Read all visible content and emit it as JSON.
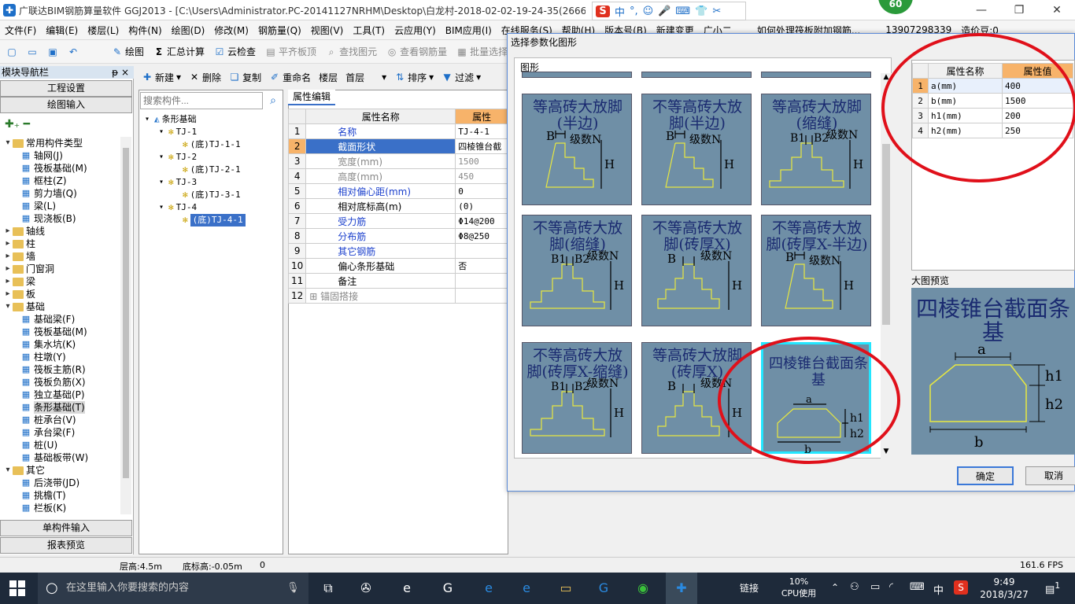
{
  "window": {
    "title": "广联达BIM钢筋算量软件 GGJ2013 - [C:\\Users\\Administrator.PC-20141127NRHM\\Desktop\\白龙村-2018-02-02-19-24-35(2666版",
    "score": "60"
  },
  "ime": {
    "logo": "S",
    "items": [
      "中",
      "°,",
      "☺",
      "🎤",
      "⌨",
      "👕",
      "✂"
    ]
  },
  "menu": [
    "文件(F)",
    "编辑(E)",
    "楼层(L)",
    "构件(N)",
    "绘图(D)",
    "修改(M)",
    "钢筋量(Q)",
    "视图(V)",
    "工具(T)",
    "云应用(Y)",
    "BIM应用(I)",
    "在线服务(S)",
    "帮助(H)",
    "版本号(B)",
    "新建变更",
    "广小二",
    "如何处理筏板附加钢筋...",
    "13907298339",
    "造价豆:0"
  ],
  "toolbar1": {
    "draw": "绘图",
    "sum": "汇总计算",
    "cloud": "云检查",
    "flat": "平齐板顶",
    "find": "查找图元",
    "view_rebar": "查看钢筋量",
    "batch": "批量选择"
  },
  "toolbar2": {
    "new": "新建",
    "delete": "删除",
    "copy": "复制",
    "rename": "重命名",
    "floor_label": "楼层",
    "floor_value": "首层",
    "sort": "排序",
    "filter": "过滤"
  },
  "nav": {
    "header": "模块导航栏",
    "pin": "ᵽ ×",
    "settings_btn": "工程设置",
    "draw_input_btn": "绘图输入",
    "single_input_btn": "单构件输入",
    "report_btn": "报表预览",
    "tree": [
      {
        "type": "folder",
        "exp": "▾",
        "label": "常用构件类型",
        "level": 0
      },
      {
        "type": "item",
        "label": "轴网(J)",
        "level": 1
      },
      {
        "type": "item",
        "label": "筏板基础(M)",
        "level": 1
      },
      {
        "type": "item",
        "label": "框柱(Z)",
        "level": 1
      },
      {
        "type": "item",
        "label": "剪力墙(Q)",
        "level": 1
      },
      {
        "type": "item",
        "label": "梁(L)",
        "level": 1
      },
      {
        "type": "item",
        "label": "现浇板(B)",
        "level": 1
      },
      {
        "type": "folder",
        "exp": "▸",
        "label": "轴线",
        "level": 0
      },
      {
        "type": "folder",
        "exp": "▸",
        "label": "柱",
        "level": 0
      },
      {
        "type": "folder",
        "exp": "▸",
        "label": "墙",
        "level": 0
      },
      {
        "type": "folder",
        "exp": "▸",
        "label": "门窗洞",
        "level": 0
      },
      {
        "type": "folder",
        "exp": "▸",
        "label": "梁",
        "level": 0
      },
      {
        "type": "folder",
        "exp": "▸",
        "label": "板",
        "level": 0
      },
      {
        "type": "folder",
        "exp": "▾",
        "label": "基础",
        "level": 0
      },
      {
        "type": "item",
        "label": "基础梁(F)",
        "level": 1
      },
      {
        "type": "item",
        "label": "筏板基础(M)",
        "level": 1
      },
      {
        "type": "item",
        "label": "集水坑(K)",
        "level": 1
      },
      {
        "type": "item",
        "label": "柱墩(Y)",
        "level": 1
      },
      {
        "type": "item",
        "label": "筏板主筋(R)",
        "level": 1
      },
      {
        "type": "item",
        "label": "筏板负筋(X)",
        "level": 1
      },
      {
        "type": "item",
        "label": "独立基础(P)",
        "level": 1
      },
      {
        "type": "item",
        "label": "条形基础(T)",
        "level": 1,
        "selected": true
      },
      {
        "type": "item",
        "label": "桩承台(V)",
        "level": 1
      },
      {
        "type": "item",
        "label": "承台梁(F)",
        "level": 1
      },
      {
        "type": "item",
        "label": "桩(U)",
        "level": 1
      },
      {
        "type": "item",
        "label": "基础板带(W)",
        "level": 1
      },
      {
        "type": "folder",
        "exp": "▾",
        "label": "其它",
        "level": 0
      },
      {
        "type": "item",
        "label": "后浇带(JD)",
        "level": 1
      },
      {
        "type": "item",
        "label": "挑檐(T)",
        "level": 1
      },
      {
        "type": "item",
        "label": "栏板(K)",
        "level": 1
      }
    ]
  },
  "components": {
    "search_placeholder": "搜索构件...",
    "tree": [
      {
        "label": "条形基础",
        "level": 0,
        "exp": "▾",
        "icon": "tri"
      },
      {
        "label": "TJ-1",
        "level": 1,
        "exp": "▾",
        "icon": "gear"
      },
      {
        "label": "(底)TJ-1-1",
        "level": 2,
        "icon": "gear"
      },
      {
        "label": "TJ-2",
        "level": 1,
        "exp": "▾",
        "icon": "gear"
      },
      {
        "label": "(底)TJ-2-1",
        "level": 2,
        "icon": "gear"
      },
      {
        "label": "TJ-3",
        "level": 1,
        "exp": "▾",
        "icon": "gear"
      },
      {
        "label": "(底)TJ-3-1",
        "level": 2,
        "icon": "gear"
      },
      {
        "label": "TJ-4",
        "level": 1,
        "exp": "▾",
        "icon": "gear"
      },
      {
        "label": "(底)TJ-4-1",
        "level": 2,
        "icon": "gear",
        "selected": true
      }
    ]
  },
  "props": {
    "tab": "属性编辑",
    "col_name": "属性名称",
    "col_value": "属性",
    "rows": [
      {
        "n": "1",
        "name": "名称",
        "value": "TJ-4-1",
        "style": "blue"
      },
      {
        "n": "2",
        "name": "截面形状",
        "value": "四棱锥台截",
        "style": "sel"
      },
      {
        "n": "3",
        "name": "宽度(mm)",
        "value": "1500",
        "style": "gray"
      },
      {
        "n": "4",
        "name": "高度(mm)",
        "value": "450",
        "style": "gray"
      },
      {
        "n": "5",
        "name": "相对偏心距(mm)",
        "value": "0",
        "style": "blue"
      },
      {
        "n": "6",
        "name": "相对底标高(m)",
        "value": "(0)",
        "style": ""
      },
      {
        "n": "7",
        "name": "受力筋",
        "value": "Φ14@200",
        "style": "blue"
      },
      {
        "n": "8",
        "name": "分布筋",
        "value": "Φ8@250",
        "style": "blue"
      },
      {
        "n": "9",
        "name": "其它钢筋",
        "value": "",
        "style": "blue"
      },
      {
        "n": "10",
        "name": "偏心条形基础",
        "value": "否",
        "style": ""
      },
      {
        "n": "11",
        "name": "备注",
        "value": "",
        "style": ""
      },
      {
        "n": "12",
        "name": "锚固搭接",
        "value": "",
        "style": "gray",
        "plus": true
      }
    ]
  },
  "dialog": {
    "title": "选择参数化图形",
    "group": "图形",
    "shapes": [
      {
        "title": "等高砖大放脚(半边)",
        "kind": "half"
      },
      {
        "title": "不等高砖大放脚(半边)",
        "kind": "half"
      },
      {
        "title": "等高砖大放脚(缩缝)",
        "kind": "joint"
      },
      {
        "title": "不等高砖大放脚(缩缝)",
        "kind": "joint"
      },
      {
        "title": "不等高砖大放脚(砖厚X)",
        "kind": "full"
      },
      {
        "title": "不等高砖大放脚(砖厚X-半边)",
        "kind": "half"
      },
      {
        "title": "不等高砖大放脚(砖厚X-缩缝)",
        "kind": "joint"
      },
      {
        "title": "等高砖大放脚(砖厚X)",
        "kind": "full"
      },
      {
        "title": "四棱锥台截面条基",
        "kind": "trap",
        "selected": true
      }
    ],
    "labels": {
      "b": "B",
      "b1": "B1",
      "b2": "B2",
      "n": "级数N",
      "h": "H",
      "a": "a",
      "bb": "b",
      "h1": "h1",
      "h2": "h2"
    },
    "attr_header_name": "属性名称",
    "attr_header_value": "属性值",
    "attrs": [
      {
        "n": "1",
        "name": "a(mm)",
        "value": "400"
      },
      {
        "n": "2",
        "name": "b(mm)",
        "value": "1500"
      },
      {
        "n": "3",
        "name": "h1(mm)",
        "value": "200"
      },
      {
        "n": "4",
        "name": "h2(mm)",
        "value": "250"
      }
    ],
    "preview_label": "大图预览",
    "preview_title": "四棱锥台截面条基",
    "ok": "确定",
    "cancel": "取消"
  },
  "status": {
    "floor_height": "层高:4.5m",
    "base_height": "底标高:-0.05m",
    "zero": "0",
    "fps": "161.6 FPS"
  },
  "taskbar": {
    "search": "在这里输入你要搜索的内容",
    "tray_link": "链接",
    "cpu_pct": "10%",
    "cpu_label": "CPU使用",
    "ime": "中",
    "time": "9:49",
    "date": "2018/3/27",
    "notify": "1"
  }
}
